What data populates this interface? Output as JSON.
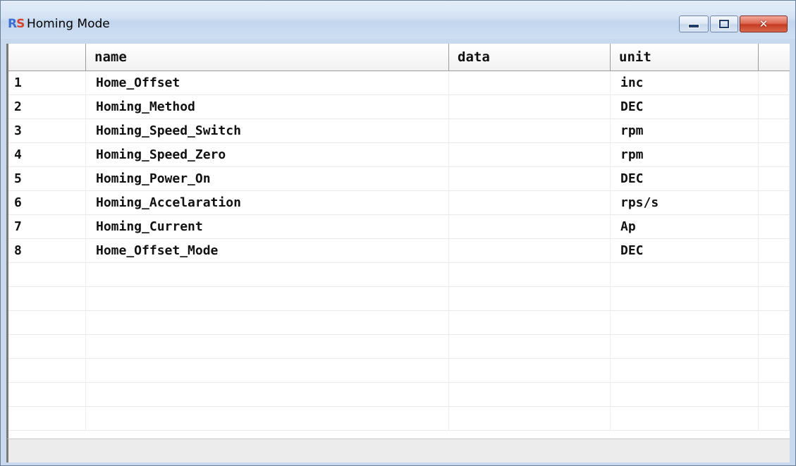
{
  "window": {
    "title": "Homing Mode",
    "icon_letters": {
      "r": "R",
      "s": "S"
    }
  },
  "controls": {
    "minimize": "minimize-icon",
    "maximize": "maximize-icon",
    "close": "close-icon"
  },
  "table": {
    "columns": [
      "",
      "name",
      "data",
      "unit"
    ],
    "rows": [
      {
        "index": "1",
        "name": "Home_Offset",
        "data": "",
        "unit": "inc"
      },
      {
        "index": "2",
        "name": "Homing_Method",
        "data": "",
        "unit": "DEC"
      },
      {
        "index": "3",
        "name": "Homing_Speed_Switch",
        "data": "",
        "unit": "rpm"
      },
      {
        "index": "4",
        "name": "Homing_Speed_Zero",
        "data": "",
        "unit": "rpm"
      },
      {
        "index": "5",
        "name": "Homing_Power_On",
        "data": "",
        "unit": "DEC"
      },
      {
        "index": "6",
        "name": "Homing_Accelaration",
        "data": "",
        "unit": "rps/s"
      },
      {
        "index": "7",
        "name": "Homing_Current",
        "data": "",
        "unit": "Ap"
      },
      {
        "index": "8",
        "name": "Home_Offset_Mode",
        "data": "",
        "unit": "DEC"
      }
    ],
    "empty_rows": 7
  }
}
